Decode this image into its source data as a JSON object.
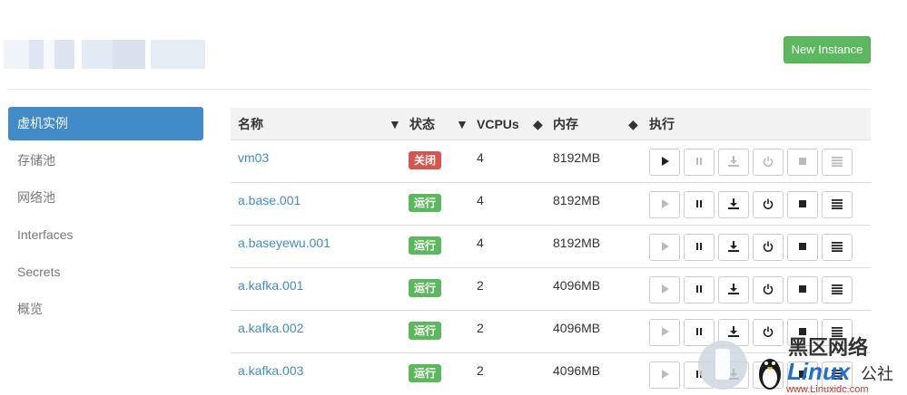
{
  "header": {
    "new_instance_label": "New Instance"
  },
  "sidebar": {
    "items": [
      {
        "label": "虚机实例",
        "active": true
      },
      {
        "label": "存储池",
        "active": false
      },
      {
        "label": "网络池",
        "active": false
      },
      {
        "label": "Interfaces",
        "active": false
      },
      {
        "label": "Secrets",
        "active": false
      },
      {
        "label": "概览",
        "active": false
      }
    ]
  },
  "table": {
    "headers": {
      "name": "名称",
      "state": "状态",
      "vcpus": "VCPUs",
      "memory": "内存",
      "actions": "执行"
    },
    "rows": [
      {
        "name": "vm03",
        "state": "关闭",
        "vcpus": "4",
        "memory": "8192MB"
      },
      {
        "name": "a.base.001",
        "state": "运行",
        "vcpus": "4",
        "memory": "8192MB"
      },
      {
        "name": "a.baseyewu.001",
        "state": "运行",
        "vcpus": "4",
        "memory": "8192MB"
      },
      {
        "name": "a.kafka.001",
        "state": "运行",
        "vcpus": "2",
        "memory": "4096MB"
      },
      {
        "name": "a.kafka.002",
        "state": "运行",
        "vcpus": "2",
        "memory": "4096MB"
      },
      {
        "name": "a.kafka.003",
        "state": "运行",
        "vcpus": "2",
        "memory": "4096MB"
      }
    ],
    "action_icons": [
      "play-icon",
      "pause-icon",
      "download-icon",
      "power-icon",
      "stop-icon",
      "menu-icon"
    ]
  },
  "watermark": {
    "title": "黑区网络",
    "logo": "Linux",
    "suffix": "公社",
    "url": "www.Linuxidc.com"
  },
  "colors": {
    "primary": "#428bca",
    "success": "#5cb85c",
    "danger": "#d9534f"
  }
}
